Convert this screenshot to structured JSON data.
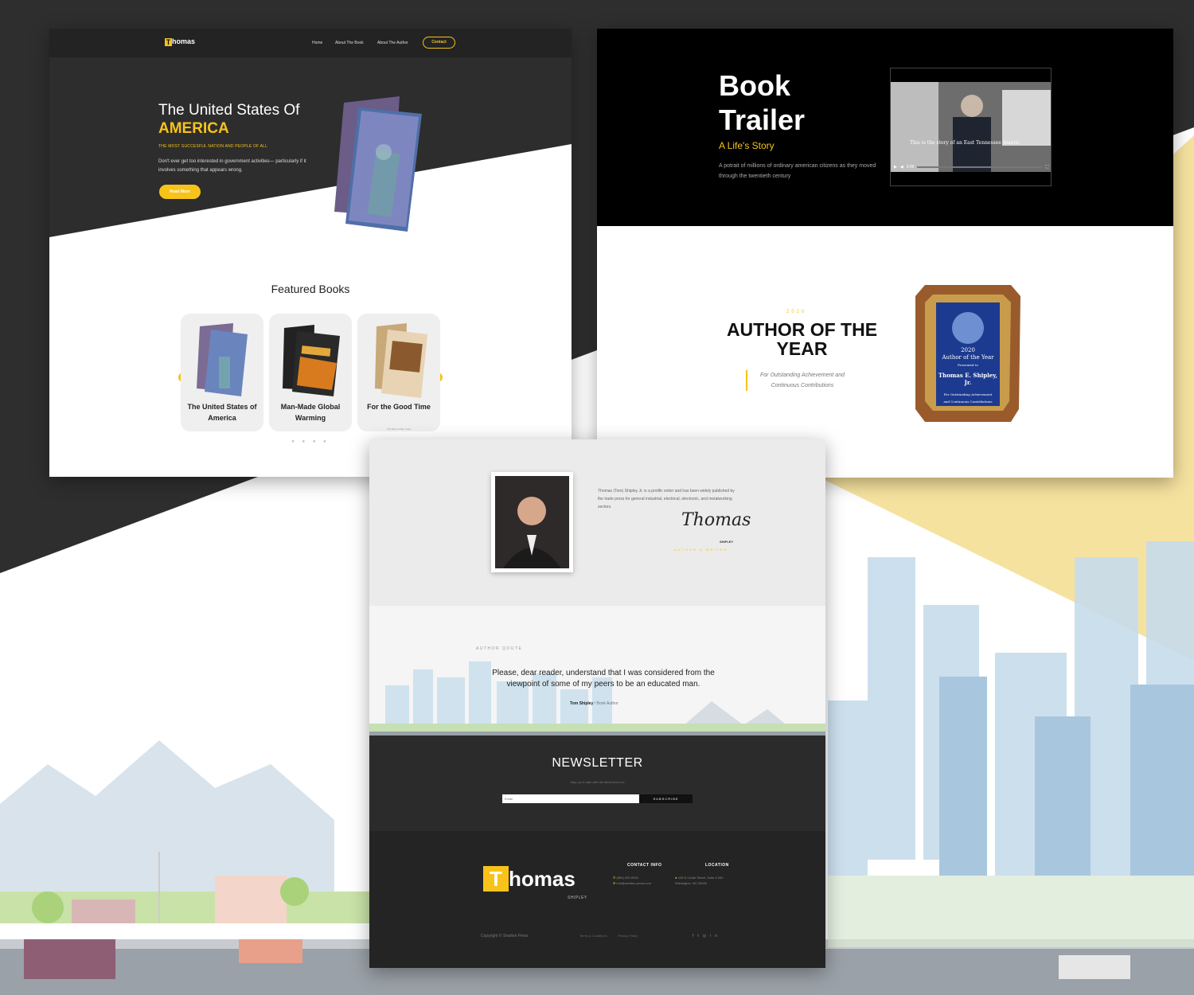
{
  "colors": {
    "accent": "#f7c31a",
    "dark": "#232323",
    "black": "#000000"
  },
  "home": {
    "logo_letter": "T",
    "logo_text": "homas",
    "nav": {
      "home": "Home",
      "about_book": "About The Book",
      "about_author": "About The Author",
      "contact": "Contact"
    },
    "hero": {
      "title": "The United States Of",
      "title_accent": "AMERICA",
      "subtitle": "THE MOST SUCCESFUL NATION AND PEOPLE OF ALL",
      "description": "Don't ever get too interested in government activities— particularly if it involves something that appears wrong.",
      "button": "Read More"
    },
    "featured_title": "Featured Books",
    "books": [
      {
        "title": "The United States of America"
      },
      {
        "title": "Man-Made Global Warming"
      },
      {
        "title": "For the Good Time",
        "tagline": "The Best of Fifty Years"
      }
    ],
    "carousel": {
      "prev_icon": "chevron-left-icon",
      "next_icon": "chevron-right-icon"
    }
  },
  "trailer": {
    "title": "Book Trailer",
    "subtitle": "A Life's Story",
    "description": "A potrait of millions of ordinary american citizens as they moved through the twentieth century",
    "video_caption": "This is the story of an East Tennessee Americ",
    "video_time": "0:00"
  },
  "award": {
    "year": "2020",
    "title": "AUTHOR OF THE YEAR",
    "description": "For Outstanding Achievement and Continuous Contributions",
    "plaque": {
      "year_line": "2020",
      "line": "Author of the Year",
      "presented": "Presented to",
      "name": "Thomas E. Shipley, Jr.",
      "for_line": "For Outstanding Achievement",
      "and_line": "and Continuous Contributions"
    }
  },
  "author": {
    "bio": "Thomas (Tom) Shipley Jr. is a prolific writer and has been widely published by the trade press for general industrial, electrical, electronic, and metalworking sectors.",
    "signature": "Thomas",
    "signature_sub": "SHIPLEY",
    "role": "AUTHOR & WRITER",
    "quote_label": "AUTHOR QOUTE",
    "quote": "Please, dear reader, understand that I was considered from the viewpoint of some of my peers to be an educated man.",
    "quote_author": "Tom Shipley",
    "quote_role": "/ Book Author"
  },
  "newsletter": {
    "title": "NEWSLETTER",
    "subtitle": "Stay up to date with the latest from me",
    "placeholder": "Email",
    "button": "SUBSCRIBE"
  },
  "footer": {
    "logo_letter": "T",
    "logo_text": "homas",
    "logo_sub": "SHIPLEY",
    "contact_title": "CONTACT INFO",
    "phone": "(865) 000-0000",
    "email": "info@stratton-press.com",
    "location_title": "LOCATION",
    "address": "445 N Cedar Street, Suite # 000 Wilmington, NC 00000",
    "copyright": "Copyright © Stratton Press",
    "terms": "Terms & Conditions",
    "privacy": "Privacy Policy",
    "social": [
      "facebook-icon",
      "twitter-icon",
      "instagram-icon",
      "linkedin-icon"
    ]
  }
}
